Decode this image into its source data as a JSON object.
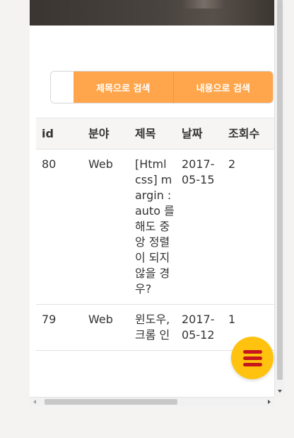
{
  "search": {
    "placeholder": "",
    "title_button": "제목으로 검색",
    "content_button": "내용으로 검색"
  },
  "table": {
    "headers": [
      "id",
      "분야",
      "제목",
      "날짜",
      "조회수"
    ],
    "rows": [
      {
        "id": "80",
        "category": "Web",
        "title": "[Html css] margin : auto 를 해도 중앙 정렬이 되지 않을 경우?",
        "date": "2017-05-15",
        "views": "2"
      },
      {
        "id": "79",
        "category": "Web",
        "title": "윈도우, 크롬 인",
        "date": "2017-05-12",
        "views": "1"
      }
    ]
  },
  "colors": {
    "accent": "#ffa64c",
    "fab": "#ffc20e",
    "fab_icon": "#c4161c"
  },
  "icons": {
    "fab": "hamburger-menu-icon"
  }
}
